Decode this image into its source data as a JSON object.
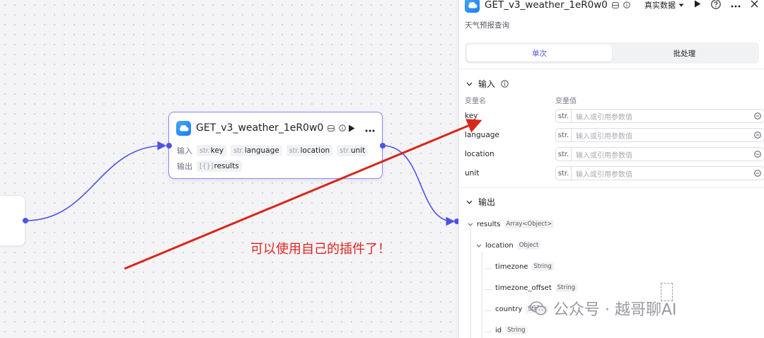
{
  "node": {
    "title": "GET_v3_weather_1eR0w0",
    "input_label": "输入",
    "output_label": "输出",
    "inputs": [
      {
        "type": "str.",
        "name": "key"
      },
      {
        "type": "str.",
        "name": "language"
      },
      {
        "type": "str.",
        "name": "location"
      },
      {
        "type": "str.",
        "name": "unit"
      }
    ],
    "outputs": [
      {
        "type": "[{}]",
        "name": "results"
      }
    ]
  },
  "annotation": "可以使用自己的插件了！",
  "panel": {
    "title": "GET_v3_weather_1eR0w0",
    "mode": "真实数据",
    "description": "天气预报查询",
    "tabs": [
      "单次",
      "批处理"
    ],
    "input_section": "输入",
    "col_name": "变量名",
    "col_value": "变量值",
    "variables": [
      {
        "name": "key",
        "type": "str.",
        "placeholder": "输入或引用参数值"
      },
      {
        "name": "language",
        "type": "str.",
        "placeholder": "输入或引用参数值"
      },
      {
        "name": "location",
        "type": "str.",
        "placeholder": "输入或引用参数值"
      },
      {
        "name": "unit",
        "type": "str.",
        "placeholder": "输入或引用参数值"
      }
    ],
    "output_section": "输出",
    "output_tree": [
      {
        "name": "results",
        "type": "Array<Object>"
      },
      {
        "name": "location",
        "type": "Object"
      },
      {
        "name": "timezone",
        "type": "String"
      },
      {
        "name": "timezone_offset",
        "type": "String"
      },
      {
        "name": "country",
        "type": "String"
      },
      {
        "name": "id",
        "type": "String"
      }
    ]
  },
  "watermark": "公众号 · 越哥聊AI",
  "colors": {
    "accent": "#4d53e8",
    "annotation": "#e0241e",
    "node_border": "#8a86f2"
  }
}
